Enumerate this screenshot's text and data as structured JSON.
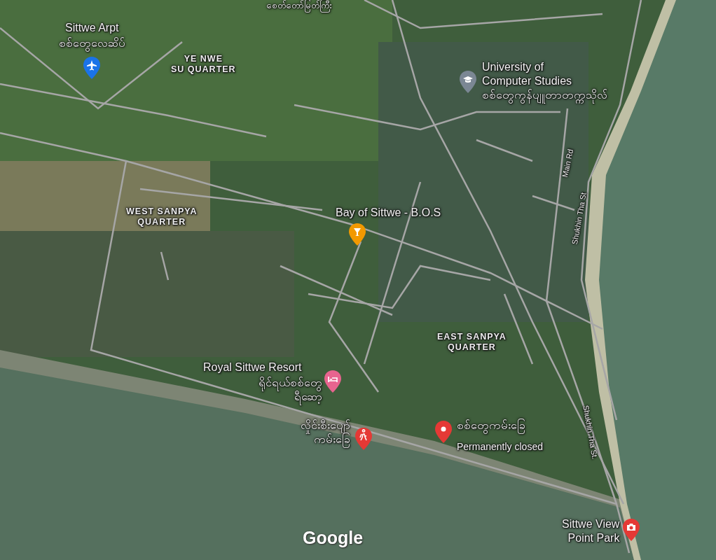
{
  "map": {
    "top_label": "စေတ်တော်မြတ်ကြီး",
    "areas": [
      {
        "lines": [
          "YE NWE",
          "SU QUARTER"
        ]
      },
      {
        "lines": [
          "WEST SANPYA",
          "QUARTER"
        ]
      },
      {
        "lines": [
          "EAST SANPYA",
          "QUARTER"
        ]
      }
    ],
    "roads": [
      {
        "name": "Main Rd"
      },
      {
        "name": "Shukhin Tha St"
      },
      {
        "name": "Shukhin Tha St."
      }
    ],
    "places": [
      {
        "kind": "airport",
        "color": "#1a73e8",
        "name": [
          "Sittwe Arpt"
        ],
        "local_name": [
          "စစ်တွေလေဆိပ်"
        ]
      },
      {
        "kind": "education",
        "color": "#7b8794",
        "name": [
          "University of",
          "Computer Studies"
        ],
        "local_name": [
          "စစ်တွေကွန်ပျူတာတက္ကသိုလ်"
        ]
      },
      {
        "kind": "bar",
        "color": "#f29900",
        "name": [
          "Bay of Sittwe - B.O.S"
        ]
      },
      {
        "kind": "hotel",
        "color": "#e8648f",
        "name": [
          "Royal Sittwe Resort"
        ],
        "local_name": [
          "ရိုင်ရယ်စစ်တွေ",
          "ရီဆော့"
        ]
      },
      {
        "kind": "hiking",
        "color": "#e53935",
        "local_name": [
          "လှိုင်းစီးပျော်",
          "ကမ်းခြေ"
        ]
      },
      {
        "kind": "place",
        "color": "#e53935",
        "local_name": [
          "စစ်တွေကမ်းခြေ"
        ],
        "note": "Permanently closed"
      },
      {
        "kind": "camera",
        "color": "#e53935",
        "name": [
          "Sittwe View",
          "Point Park"
        ]
      }
    ],
    "logo": "Google"
  }
}
